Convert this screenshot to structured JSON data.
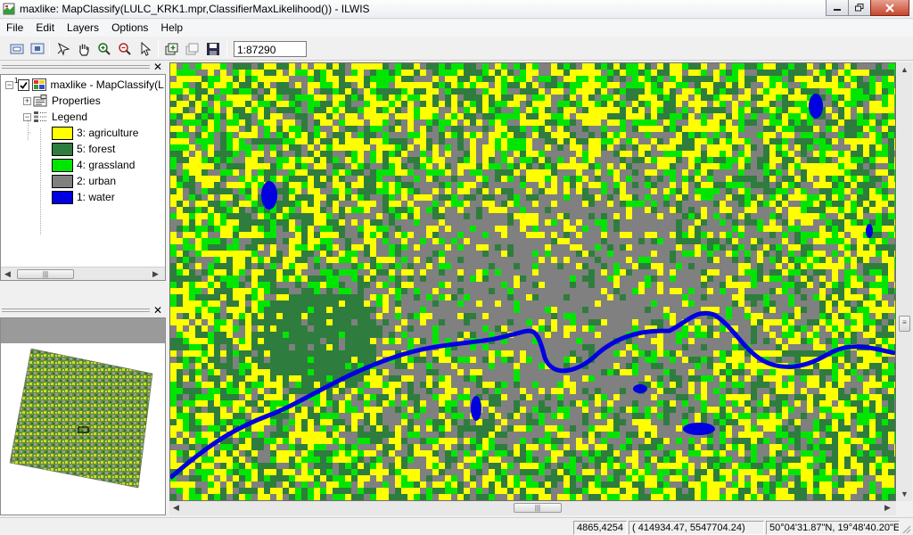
{
  "window": {
    "title": "maxlike: MapClassify(LULC_KRK1.mpr,ClassifierMaxLikelihood()) - ILWIS",
    "minimize_icon": "minimize-icon",
    "maximize_icon": "restore-icon",
    "close_icon": "close-icon"
  },
  "menu": [
    "File",
    "Edit",
    "Layers",
    "Options",
    "Help"
  ],
  "toolbar": {
    "scale": "1:87290",
    "icons": [
      "entire-map-icon",
      "overview-icon",
      "normal-pointer-icon",
      "pan-icon",
      "zoom-in-icon",
      "zoom-out-icon",
      "select-icon",
      "add-layer-icon",
      "remove-layer-icon",
      "save-icon"
    ]
  },
  "layers_panel": {
    "map_name": "maxlike - MapClassify(L",
    "properties_label": "Properties",
    "legend_label": "Legend",
    "legend": [
      {
        "label": "3: agriculture",
        "color": "#ffff00"
      },
      {
        "label": "5: forest",
        "color": "#2e7d3e"
      },
      {
        "label": "4: grassland",
        "color": "#00e600"
      },
      {
        "label": "2: urban",
        "color": "#808080"
      },
      {
        "label": "1: water",
        "color": "#0000e0"
      }
    ]
  },
  "status": {
    "rowcol": "4865,4254",
    "coords": "(  414934.47,  5547704.24)",
    "latlon": "50°04'31.87\"N, 19°48'40.20\"E"
  },
  "colors": {
    "agriculture": "#ffff00",
    "forest": "#2e7d3e",
    "grassland": "#00e600",
    "urban": "#808080",
    "water": "#0000e0"
  }
}
